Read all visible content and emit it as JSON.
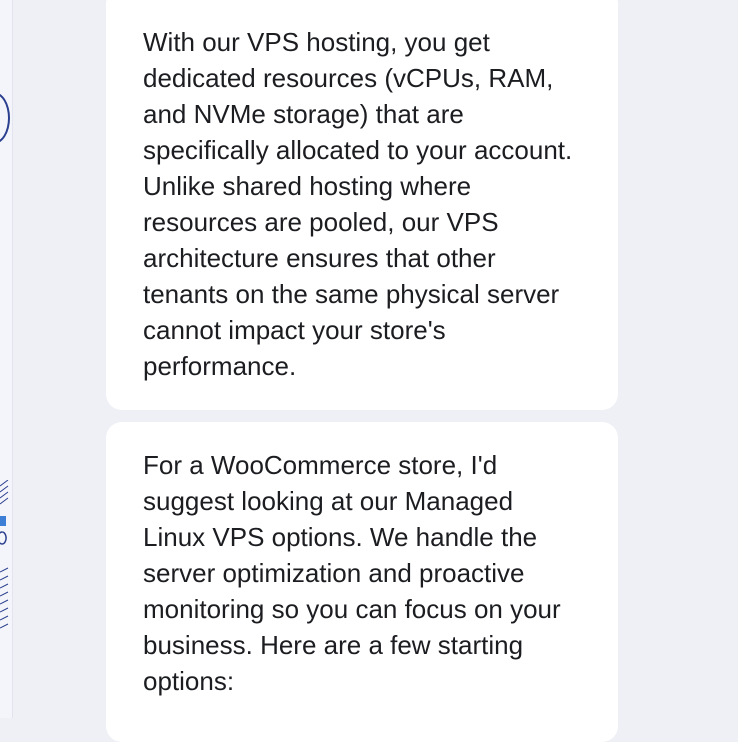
{
  "messages": [
    {
      "role": "assistant",
      "text": "With our VPS hosting, you get dedicated resources (vCPUs, RAM, and NVMe storage) that are specifically allocated to your account. Unlike shared hosting where resources are pooled, our VPS architecture ensures that other tenants on the same physical server cannot impact your store's performance."
    },
    {
      "role": "assistant",
      "text": "For a WooCommerce store, I'd suggest looking at our Managed Linux VPS options. We handle the server optimization and proactive monitoring so you can focus on your business. Here are a few starting options:"
    }
  ],
  "theme": {
    "page_background": "#eef0f6",
    "bubble_background": "#ffffff",
    "text_color": "#1c1d21",
    "decoration_color": "#2b3f8f"
  }
}
